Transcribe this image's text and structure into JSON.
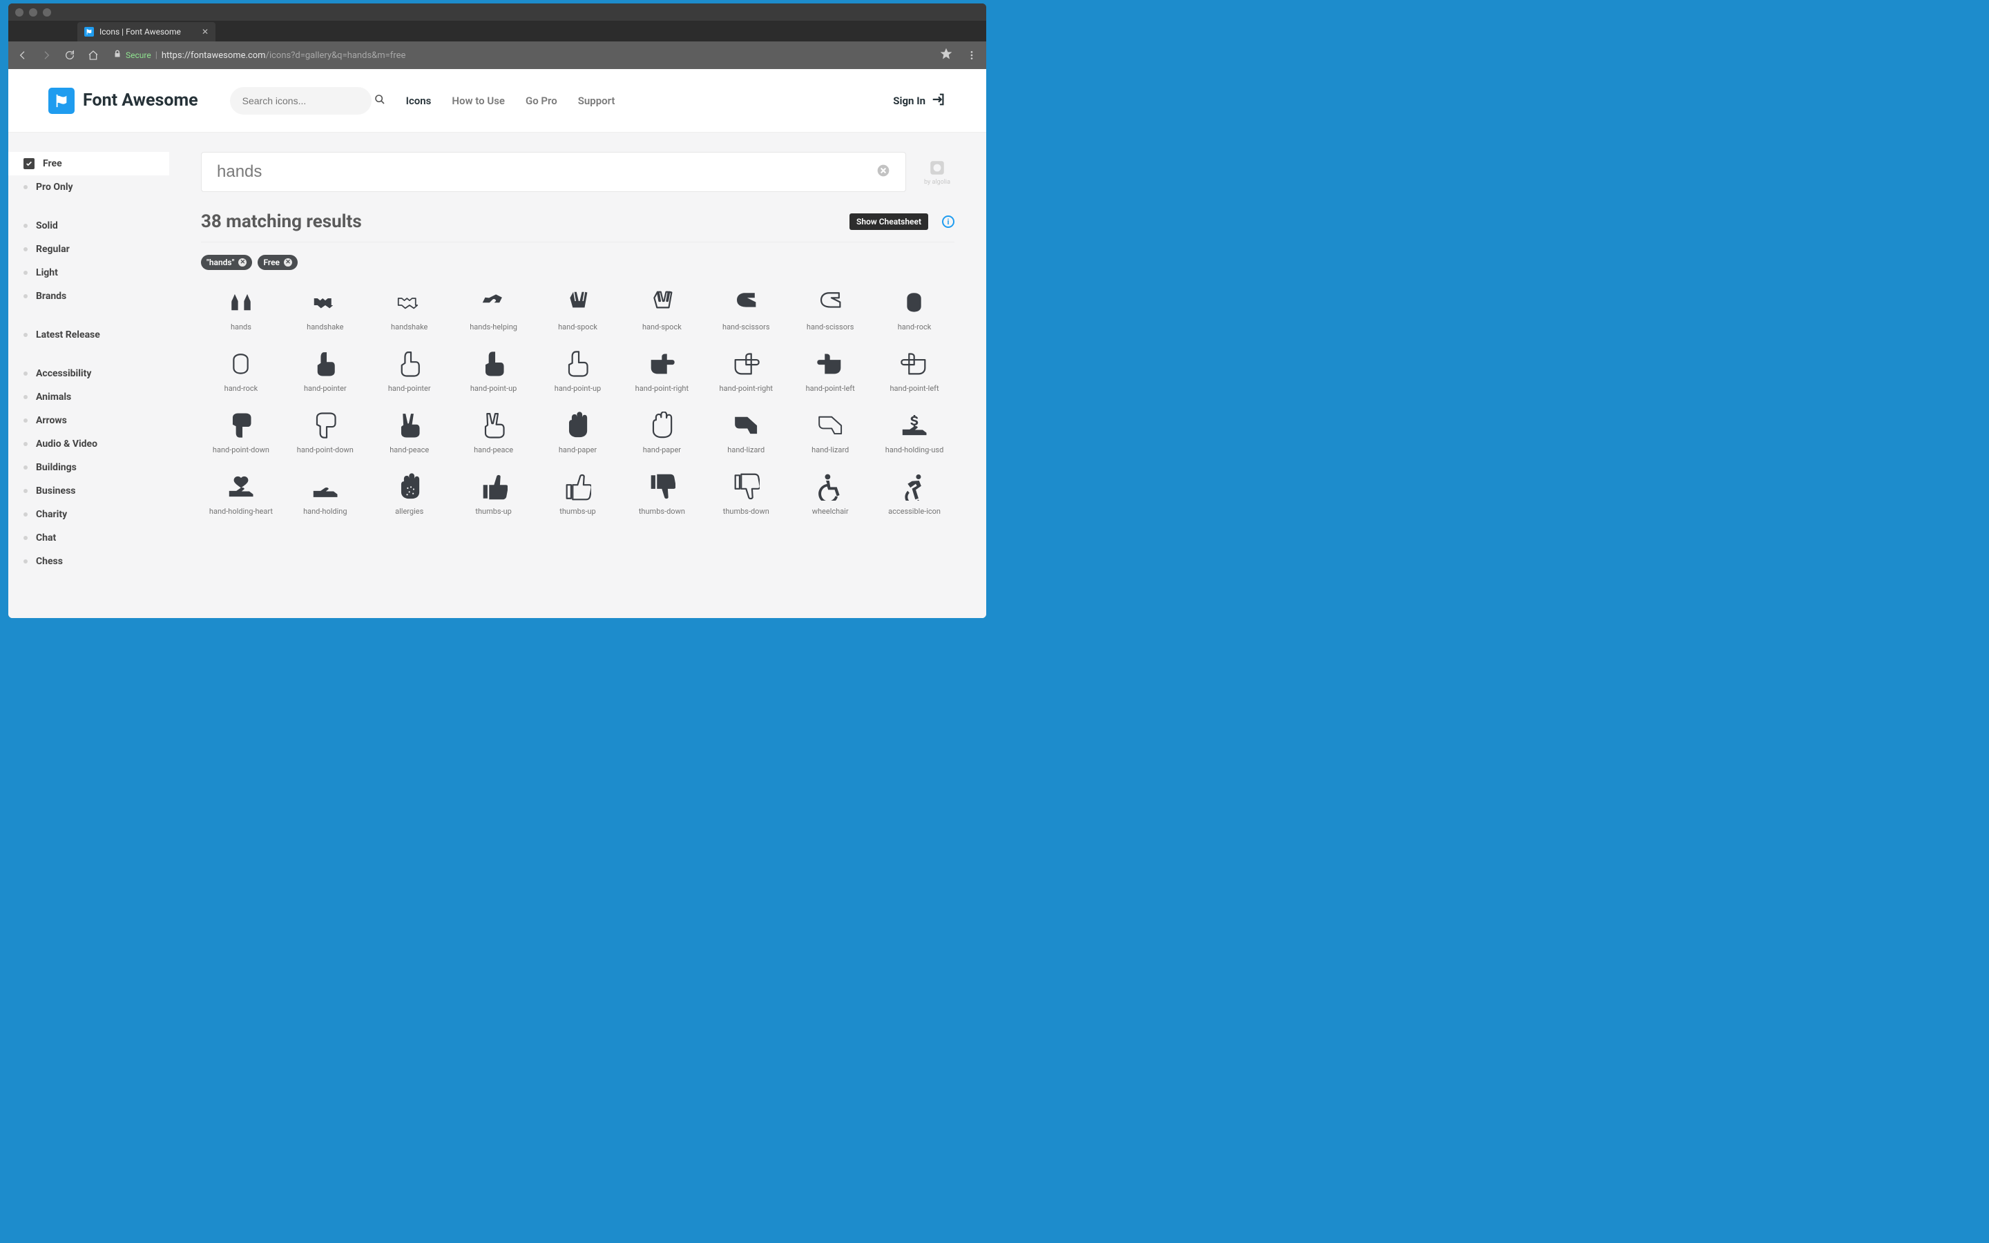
{
  "browser": {
    "tab_title": "Icons | Font Awesome",
    "secure_label": "Secure",
    "url_main": "https://fontawesome.com",
    "url_path": "/icons?d=gallery&q=hands&m=free"
  },
  "header": {
    "brand": "Font Awesome",
    "search_placeholder": "Search icons...",
    "nav": {
      "icons": "Icons",
      "howto": "How to Use",
      "gopro": "Go Pro",
      "support": "Support"
    },
    "signin": "Sign In"
  },
  "sidebar": {
    "filters": {
      "free": "Free",
      "pro": "Pro Only"
    },
    "styles": {
      "solid": "Solid",
      "regular": "Regular",
      "light": "Light",
      "brands": "Brands"
    },
    "latest": "Latest Release",
    "categories": {
      "accessibility": "Accessibility",
      "animals": "Animals",
      "arrows": "Arrows",
      "audiovideo": "Audio & Video",
      "buildings": "Buildings",
      "business": "Business",
      "charity": "Charity",
      "chat": "Chat",
      "chess": "Chess"
    }
  },
  "main": {
    "search_value": "hands",
    "algolia_caption": "by algolia",
    "results_heading": "38 matching results",
    "cheatsheet_label": "Show Cheatsheet",
    "chips": {
      "hands": "\"hands\"",
      "free": "Free"
    }
  },
  "grid": {
    "row1": [
      "hands",
      "handshake",
      "handshake",
      "hands-helping",
      "hand-spock",
      "hand-spock",
      "hand-scissors",
      "hand-scissors",
      "hand-rock"
    ],
    "row2": [
      "hand-rock",
      "hand-pointer",
      "hand-pointer",
      "hand-point-up",
      "hand-point-up",
      "hand-point-right",
      "hand-point-right",
      "hand-point-left",
      "hand-point-left"
    ],
    "row3": [
      "hand-point-down",
      "hand-point-down",
      "hand-peace",
      "hand-peace",
      "hand-paper",
      "hand-paper",
      "hand-lizard",
      "hand-lizard",
      "hand-holding-usd"
    ],
    "row4": [
      "hand-holding-heart",
      "hand-holding",
      "allergies",
      "thumbs-up",
      "thumbs-up",
      "thumbs-down",
      "thumbs-down",
      "wheelchair",
      "accessible-icon"
    ]
  }
}
